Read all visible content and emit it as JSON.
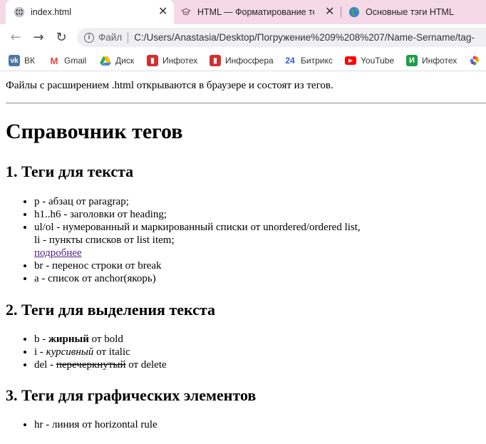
{
  "tabs": [
    {
      "title": "index.html",
      "active": true
    },
    {
      "title": "HTML — Форматирование текс"
    },
    {
      "title": "Основные тэги HTML"
    }
  ],
  "address": {
    "scheme_label": "Файл",
    "url": "C:/Users/Anastasia/Desktop/Погружение%209%208%207/Name-Sername/tag-"
  },
  "bookmarks": [
    {
      "label": "ВК",
      "icon": "vk-icon",
      "color": "#4a76a8"
    },
    {
      "label": "Gmail",
      "icon": "gmail-icon",
      "color": "#ea4335"
    },
    {
      "label": "Диск",
      "icon": "drive-icon",
      "color": "#34a853"
    },
    {
      "label": "Инфотех",
      "icon": "infotech-icon",
      "color": "#d32f2f"
    },
    {
      "label": "Инфосфера",
      "icon": "infosfera-icon",
      "color": "#d32f2f"
    },
    {
      "label": "Битрикс",
      "icon": "bitrix24-icon",
      "color": "#2a5bd7"
    },
    {
      "label": "YouTube",
      "icon": "youtube-icon",
      "color": "#ff0000"
    },
    {
      "label": "Инфотех",
      "icon": "infotech-green-icon",
      "color": "#1e9e4a"
    }
  ],
  "page": {
    "intro": "Файлы с расширением .html открываются в браузере и состоят из тегов.",
    "title": "Справочник тегов",
    "sections": [
      {
        "heading": "1. Теги для текста",
        "items": {
          "p": "p - абзац от paragrap;",
          "h": "h1..h6 - заголовки от heading;",
          "ul_line1": "ul/ol - нумерованный и маркированный списки от unordered/ordered list,",
          "ul_line2": "li - пункты списков от list item;",
          "ul_link": "подробнее",
          "br": "br - перенос строки от break",
          "a": "a - список от anchor(якорь)"
        }
      },
      {
        "heading": "2. Теги для выделения текста",
        "items": {
          "b_pre": "b - ",
          "b_word": "жирный",
          "b_post": " от bold",
          "i_pre": "i - ",
          "i_word": "курсивный",
          "i_post": " от italic",
          "del_pre": "del - ",
          "del_word": "перечеркнутый",
          "del_post": " от delete"
        }
      },
      {
        "heading": "3. Теги для графических элементов",
        "items": {
          "hr": "hr - линия от horizontal rule"
        }
      }
    ]
  }
}
